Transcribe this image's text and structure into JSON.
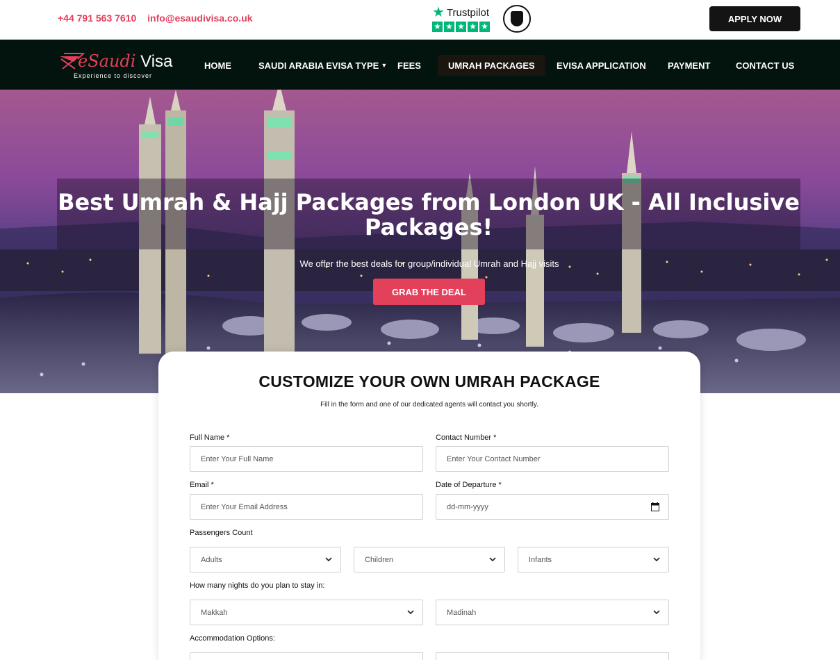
{
  "topbar": {
    "phone": "+44 791 563 7610",
    "email": "info@esaudivisa.co.uk",
    "trustpilot_label": "Trustpilot",
    "apply_label": "APPLY NOW"
  },
  "brand": {
    "name_e": "e",
    "name_saudi": "Saudi",
    "name_visa": "Visa",
    "tagline": "Experience to discover",
    "accent_color": "#e3405b"
  },
  "nav": {
    "items": [
      {
        "label": "HOME"
      },
      {
        "label": "SAUDI ARABIA EVISA TYPE"
      },
      {
        "label": "FEES"
      },
      {
        "label": "UMRAH PACKAGES"
      },
      {
        "label": "EVISA APPLICATION"
      },
      {
        "label": "PAYMENT"
      },
      {
        "label": "CONTACT US"
      }
    ]
  },
  "hero": {
    "title": "Best Umrah & Hajj Packages from London UK - All Inclusive Packages!",
    "subtitle": "We offer the best deals for group/individual Umrah and Hajj visits",
    "cta_label": "GRAB THE DEAL"
  },
  "form": {
    "title": "CUSTOMIZE YOUR OWN UMRAH PACKAGE",
    "description": "Fill in the form and one of our dedicated agents will contact you shortly.",
    "full_name_label": "Full Name *",
    "full_name_placeholder": "Enter Your Full Name",
    "contact_label": "Contact Number *",
    "contact_placeholder": "Enter Your Contact Number",
    "email_label": "Email *",
    "email_placeholder": "Enter Your Email Address",
    "departure_label": "Date of Departure *",
    "departure_placeholder": "dd-mm-yyyy",
    "passengers_label": "Passengers Count",
    "adults": "Adults",
    "children": "Children",
    "infants": "Infants",
    "nights_label": "How many nights do you plan to stay in:",
    "makkah": "Makkah",
    "madinah": "Madinah",
    "accommodation_label": "Accommodation Options:"
  }
}
